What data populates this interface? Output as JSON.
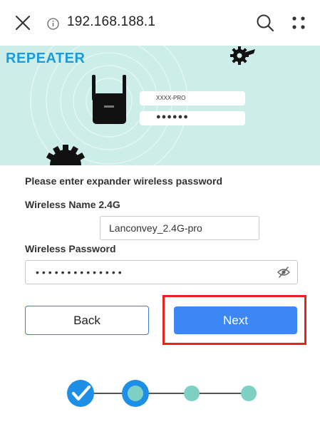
{
  "browser": {
    "url": "192.168.188.1",
    "icons": [
      "close-icon",
      "info-icon",
      "search-icon",
      "more-icon"
    ]
  },
  "banner": {
    "title": "REPEATER",
    "name_value": "XXXX-PRO",
    "password_value": "●●●●●●",
    "background": "#cdeee8",
    "title_color": "#1e9bd7"
  },
  "form": {
    "heading": "Please enter expander wireless password",
    "name_label": "Wireless Name 2.4G",
    "name_value": "Lanconvey_2.4G-pro",
    "password_label": "Wireless Password",
    "password_value": "••••••••••••••"
  },
  "buttons": {
    "back": "Back",
    "next": "Next",
    "accent": "#3d86f5",
    "highlight": "#e8221c"
  },
  "stepper": {
    "total_steps": 4,
    "completed": 1,
    "current": 2
  }
}
